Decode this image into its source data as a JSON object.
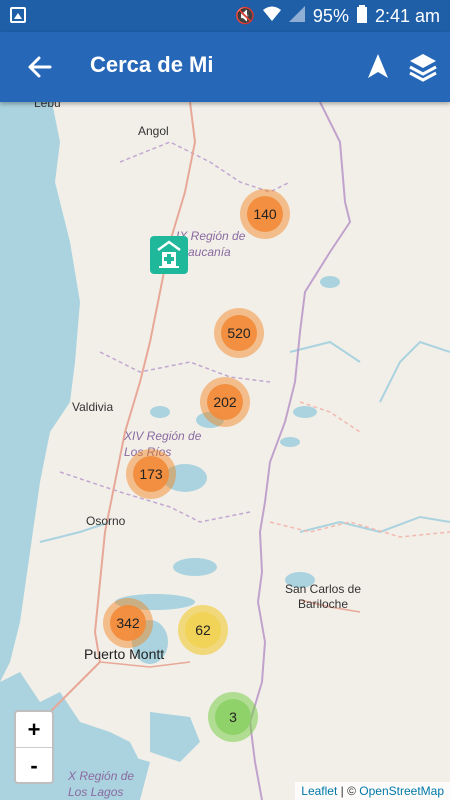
{
  "status_bar": {
    "battery": "95%",
    "time": "2:41 am"
  },
  "app_bar": {
    "title": "Cerca de Mi"
  },
  "map": {
    "cities": [
      {
        "name": "Lebu"
      },
      {
        "name": "Angol"
      },
      {
        "name": "Valdivia"
      },
      {
        "name": "Osorno"
      },
      {
        "name": "Puerto Montt"
      },
      {
        "name": "San Carlos de Bariloche"
      }
    ],
    "regions": [
      {
        "name": "IX Región de Araucanía"
      },
      {
        "name": "XIV Región de Los Ríos"
      },
      {
        "name": "X Región de Los Lagos"
      }
    ],
    "clusters": [
      {
        "count": "140",
        "color": "#f18c3c"
      },
      {
        "count": "520",
        "color": "#f18c3c"
      },
      {
        "count": "202",
        "color": "#f18c3c"
      },
      {
        "count": "173",
        "color": "#f18c3c"
      },
      {
        "count": "342",
        "color": "#f18c3c"
      },
      {
        "count": "62",
        "color": "#f1d357"
      },
      {
        "count": "3",
        "color": "#8fd26a"
      }
    ],
    "poi_icon": "hospital-icon",
    "poi_color": "#1fb89a"
  },
  "zoom": {
    "in_label": "+",
    "out_label": "-"
  },
  "attribution": {
    "leaflet": "Leaflet",
    "separator": " | © ",
    "osm": "OpenStreetMap"
  }
}
